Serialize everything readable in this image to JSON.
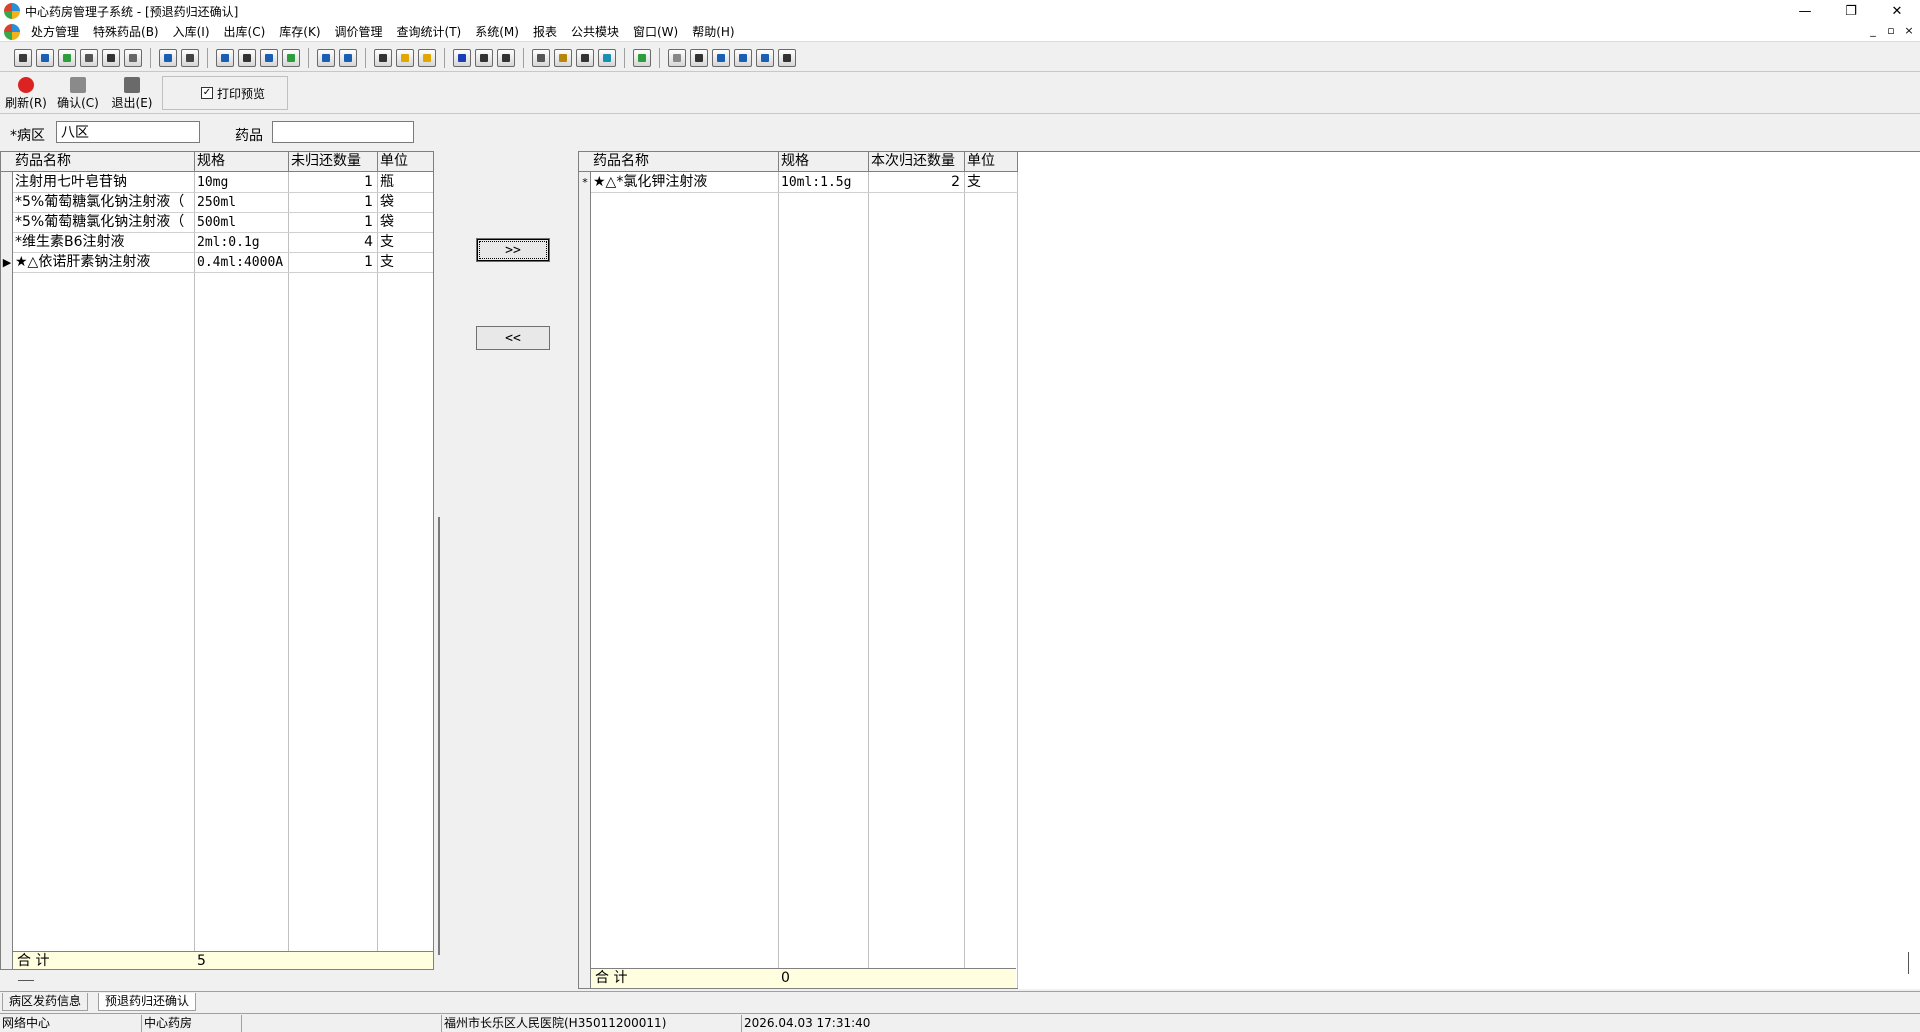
{
  "window": {
    "title": "中心药房管理子系统 - [预退药归还确认]",
    "controls": [
      "—",
      "❐",
      "✕"
    ]
  },
  "menu": [
    "处方管理",
    "特殊药品(B)",
    "入库(I)",
    "出库(C)",
    "库存(K)",
    "调价管理",
    "查询统计(T)",
    "系统(M)",
    "报表",
    "公共模块",
    "窗口(W)",
    "帮助(H)"
  ],
  "mdi_controls": [
    "_",
    "▫",
    "×"
  ],
  "actions": {
    "refresh": "刷新(R)",
    "confirm": "确认(C)",
    "exit": "退出(E)",
    "print_preview": "打印预览",
    "print_preview_checked": "✓"
  },
  "filter": {
    "ward_label": "*病区",
    "ward_value": "八区",
    "drug_label": "药品",
    "drug_value": ""
  },
  "left_grid": {
    "headers": [
      "药品名称",
      "规格",
      "未归还数量",
      "单位"
    ],
    "rows": [
      {
        "name": "注射用七叶皂苷钠",
        "spec": "10mg",
        "qty": "1",
        "unit": "瓶",
        "mark": ""
      },
      {
        "name": "*5%葡萄糖氯化钠注射液（",
        "spec": "250ml",
        "qty": "1",
        "unit": "袋",
        "mark": ""
      },
      {
        "name": "*5%葡萄糖氯化钠注射液（",
        "spec": "500ml",
        "qty": "1",
        "unit": "袋",
        "mark": ""
      },
      {
        "name": "*维生素B6注射液",
        "spec": "2ml:0.1g",
        "qty": "4",
        "unit": "支",
        "mark": ""
      },
      {
        "name": "★△依诺肝素钠注射液",
        "spec": "0.4ml:4000A",
        "qty": "1",
        "unit": "支",
        "mark": "▶"
      }
    ],
    "footer_label": "合  计",
    "footer_value": "5"
  },
  "transfer": {
    "forward": ">>",
    "back": "<<"
  },
  "right_grid": {
    "headers": [
      "药品名称",
      "规格",
      "本次归还数量",
      "单位"
    ],
    "rows": [
      {
        "name": "★△*氯化钾注射液",
        "spec": "10ml:1.5g",
        "qty": "2",
        "unit": "支",
        "mark": "*"
      }
    ],
    "footer_label": "合  计",
    "footer_value": "0"
  },
  "tabs": [
    "病区发药信息",
    "预退药归还确认"
  ],
  "status": {
    "network": "网络中心",
    "dept": "中心药房",
    "blank": "",
    "hospital": "福州市长乐区人民医院(H35011200011)",
    "datetime": "2026.04.03 17:31:40"
  },
  "colors": {
    "footer_bg": "#ffffe0",
    "grid_bg": "#ffffff",
    "chrome_bg": "#f0f0f0"
  }
}
